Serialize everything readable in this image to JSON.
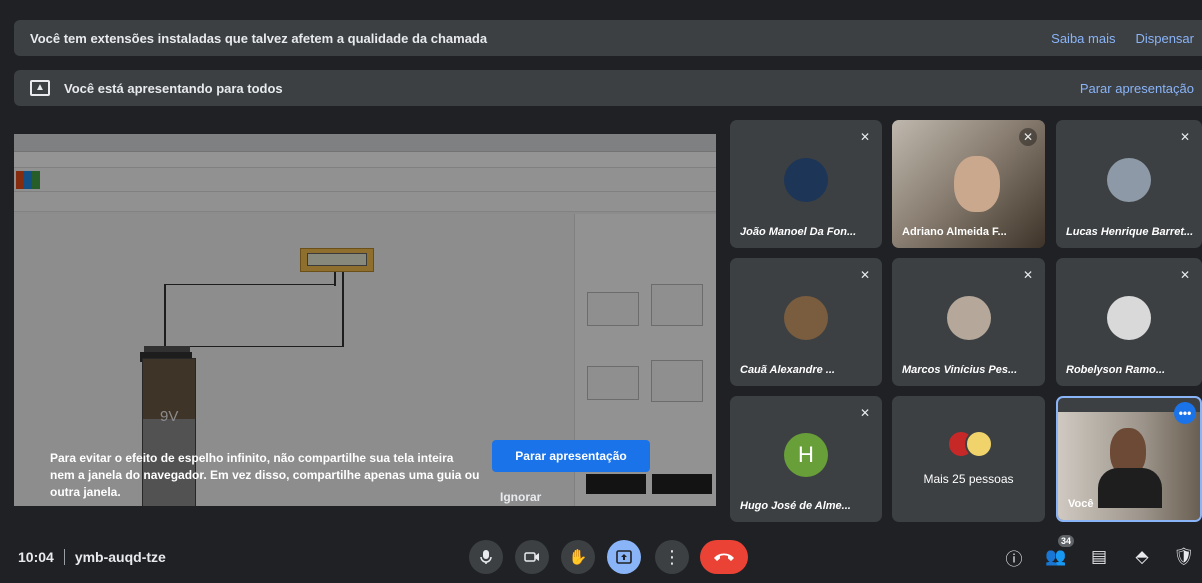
{
  "extension_banner": {
    "text": "Você tem extensões instaladas que talvez afetem a qualidade da chamada",
    "learn_more": "Saiba mais",
    "dismiss": "Dispensar"
  },
  "presenting_banner": {
    "text": "Você está apresentando para todos",
    "stop_link": "Parar apresentação"
  },
  "presentation": {
    "battery_label": "9V",
    "warning_text": "Para evitar o efeito de espelho infinito, não compartilhe sua tela inteira nem a janela do navegador. Em vez disso, compartilhe apenas uma guia ou outra janela.",
    "stop_button": "Parar apresentação",
    "ignore_button": "Ignorar"
  },
  "participants": [
    {
      "name": "João Manoel Da Fon...",
      "muted": true
    },
    {
      "name": "Adriano Almeida F...",
      "muted": true
    },
    {
      "name": "Lucas Henrique Barret...",
      "muted": true
    },
    {
      "name": "Cauã Alexandre ...",
      "muted": true
    },
    {
      "name": "Marcos Vinícius Pes...",
      "muted": true
    },
    {
      "name": "Robelyson Ramo...",
      "muted": true
    },
    {
      "name": "Hugo José de Alme...",
      "muted": true,
      "initial": "H"
    },
    {
      "name": "Mais 25 pessoas"
    },
    {
      "name": "Você"
    }
  ],
  "bottom_bar": {
    "time": "10:04",
    "meeting_code": "ymb-auqd-tze",
    "participant_count": "34"
  },
  "icons": {
    "mic": "microphone-icon",
    "camera": "camera-icon",
    "hand": "raise-hand-icon",
    "present": "present-screen-icon",
    "more": "more-options-icon",
    "end": "end-call-icon",
    "info": "info-icon",
    "people": "people-icon",
    "chat": "chat-icon",
    "activities": "activities-icon",
    "host": "host-controls-icon"
  },
  "colors": {
    "background": "#202124",
    "surface": "#3c4043",
    "accent": "#8ab4f8",
    "primary_button": "#1a73e8",
    "end_call": "#ea4335"
  }
}
